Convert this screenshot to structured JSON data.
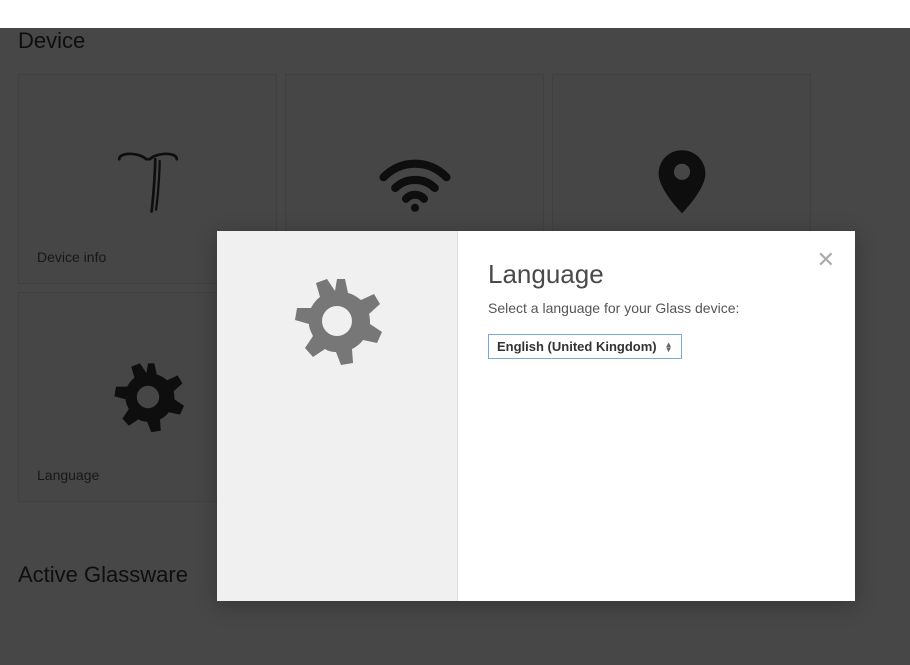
{
  "section_device_title": "Device",
  "section_glassware_title": "Active Glassware",
  "cards": {
    "device_info": {
      "label": "Device info"
    },
    "wifi": {
      "label": ""
    },
    "location": {
      "label": ""
    },
    "language": {
      "label": "Language"
    }
  },
  "modal": {
    "title": "Language",
    "subtitle": "Select a language for your Glass device:",
    "selected": "English (United Kingdom)",
    "close_glyph": "✕"
  }
}
